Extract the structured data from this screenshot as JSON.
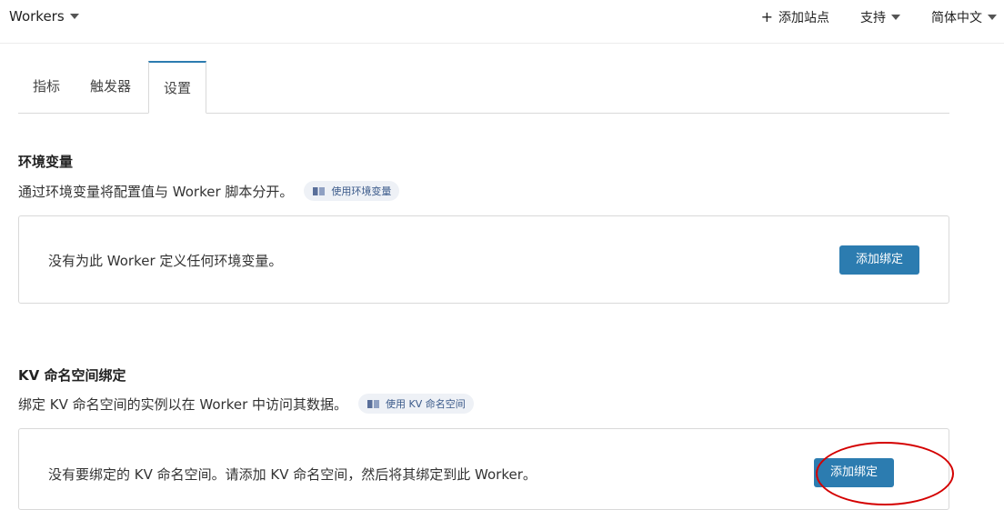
{
  "topbar": {
    "workers_label": "Workers",
    "add_site_label": "添加站点",
    "support_label": "支持",
    "language_label": "简体中文"
  },
  "tabs": [
    {
      "label": "指标",
      "active": false
    },
    {
      "label": "触发器",
      "active": false
    },
    {
      "label": "设置",
      "active": true
    }
  ],
  "env_vars": {
    "title": "环境变量",
    "description": "通过环境变量将配置值与 Worker 脚本分开。",
    "doc_link": "使用环境变量",
    "empty_text": "没有为此 Worker 定义任何环境变量。",
    "button_label": "添加绑定"
  },
  "kv": {
    "title": "KV 命名空间绑定",
    "description": "绑定 KV 命名空间的实例以在 Worker 中访问其数据。",
    "doc_link": "使用 KV 命名空间",
    "empty_text": "没有要绑定的 KV 命名空间。请添加 KV 命名空间，然后将其绑定到此 Worker。",
    "button_label": "添加绑定"
  },
  "colors": {
    "accent": "#2c7cb0",
    "highlight_annotation": "#d40000"
  },
  "icons": [
    "chevron-down-icon",
    "plus-icon",
    "book-icon"
  ]
}
